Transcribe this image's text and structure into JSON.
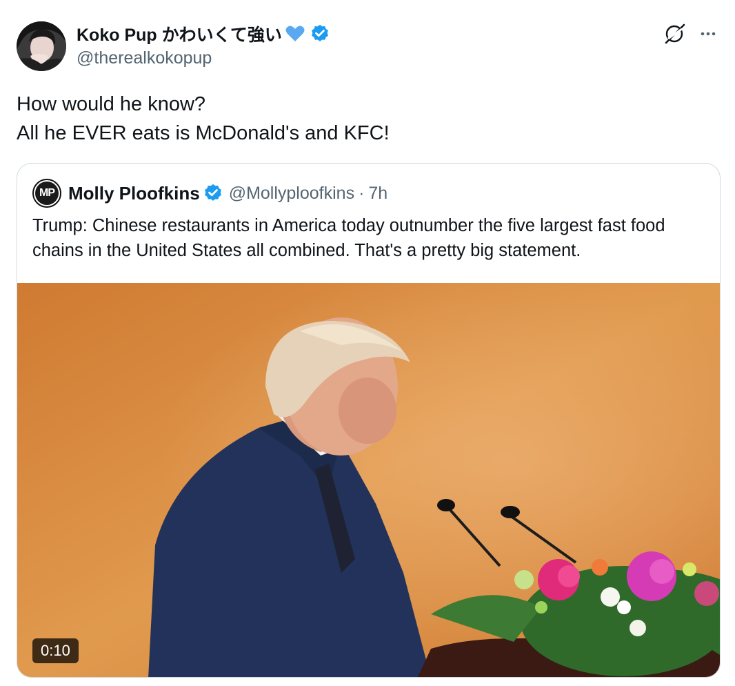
{
  "author": {
    "display_name": "Koko Pup かわいくて強い",
    "handle": "@therealkokopup",
    "avatar": "avatar-photo",
    "emoji_icon": "blue-heart-icon",
    "verified_icon": "verified-badge-icon"
  },
  "actions": {
    "grok_icon": "grok-icon",
    "more_icon": "more-options-icon"
  },
  "tweet": {
    "line1": "How would he know?",
    "line2": "All he EVER eats is McDonald's and KFC!"
  },
  "quote": {
    "avatar_initials": "MP",
    "display_name": "Molly Ploofkins",
    "handle": "@Mollyploofkins",
    "separator": "·",
    "time": "7h",
    "text": "Trump: Chinese restaurants in America today outnumber the five largest fast food chains in the United States all combined. That's a pretty big statement.",
    "video": {
      "duration": "0:10"
    }
  },
  "colors": {
    "verified": "#1d9bf0",
    "heart": "#5aa9f0",
    "secondary_text": "#536471",
    "border": "#cfd9de",
    "primary_text": "#0f1419"
  }
}
